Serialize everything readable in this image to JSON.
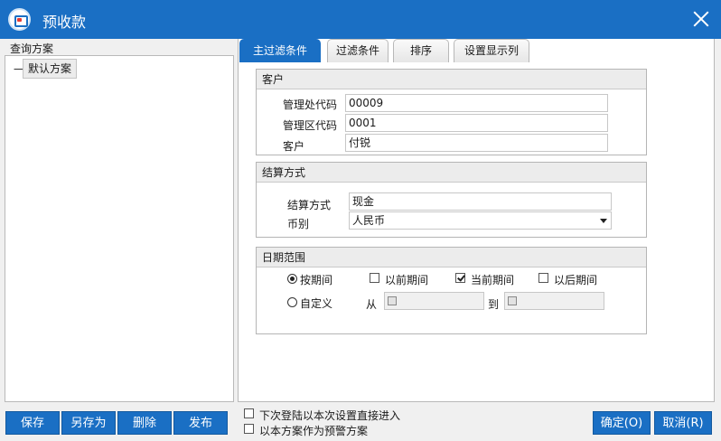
{
  "window": {
    "title": "预收款"
  },
  "left": {
    "header": "查询方案",
    "tree_dash": "一",
    "default_scheme": "默认方案"
  },
  "tabs": [
    "主过滤条件",
    "过滤条件",
    "排序",
    "设置显示列"
  ],
  "customer_group": {
    "header": "客户",
    "fields": [
      {
        "label": "管理处代码",
        "value": "00009"
      },
      {
        "label": "管理区代码",
        "value": "0001"
      },
      {
        "label": "客户",
        "value": "付锐"
      }
    ]
  },
  "settlement_group": {
    "header": "结算方式",
    "method_label": "结算方式",
    "method_value": "现金",
    "currency_label": "币别",
    "currency_value": "人民币"
  },
  "date_group": {
    "header": "日期范围",
    "by_period": "按期间",
    "prev_period": "以前期间",
    "current_period": "当前期间",
    "later_period": "以后期间",
    "custom": "自定义",
    "from": "从",
    "to": "到",
    "states": {
      "by_period": true,
      "custom": false,
      "prev_period": false,
      "current_period": true,
      "later_period": false
    }
  },
  "buttons": {
    "save": "保存",
    "save_as": "另存为",
    "delete": "删除",
    "publish": "发布",
    "ok": "确定(O)",
    "cancel": "取消(R)"
  },
  "options": {
    "direct_enter": "下次登陆以本次设置直接进入",
    "warning_scheme": "以本方案作为预警方案"
  },
  "colors": {
    "accent": "#1a6fc4"
  }
}
